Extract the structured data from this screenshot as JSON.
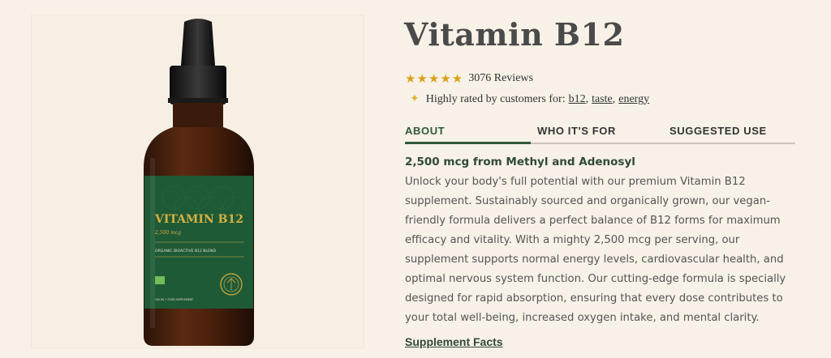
{
  "product": {
    "title": "Vitamin B12",
    "stars": "★★★★★",
    "rating_value": 5,
    "reviews_label": "3076 Reviews",
    "highlight_text": "Highly rated by customers for:",
    "highlight_tags": [
      "b12",
      "taste",
      "energy"
    ]
  },
  "tabs": [
    {
      "label": "ABOUT",
      "active": true
    },
    {
      "label": "WHO IT'S FOR",
      "active": false
    },
    {
      "label": "SUGGESTED USE",
      "active": false
    }
  ],
  "about": {
    "subheading": "2,500 mcg from Methyl and Adenosyl",
    "description": "Unlock your body's full potential with our premium Vitamin B12 supplement. Sustainably sourced and organically grown, our vegan-friendly formula delivers a perfect balance of B12 forms for maximum efficacy and vitality. With a mighty 2,500 mcg per serving, our supplement supports normal energy levels, cardiovascular health, and optimal nervous system function. Our cutting-edge formula is specially designed for rapid absorption, ensuring that every dose contributes to your total well-being, increased oxygen intake, and mental clarity.",
    "link_label": "Supplement Facts"
  },
  "label": {
    "name": "VITAMIN B12",
    "dose": "2,500 mcg",
    "blend": "ORGANIC BIOACTIVE B12 BLEND",
    "footer": "100 ML • FOOD SUPPLEMENT"
  },
  "colors": {
    "accent": "#2f5a3b",
    "star": "#d9a21b",
    "background": "#f8f1e7",
    "label_green": "#1f5a37",
    "gold": "#d6b03f"
  }
}
